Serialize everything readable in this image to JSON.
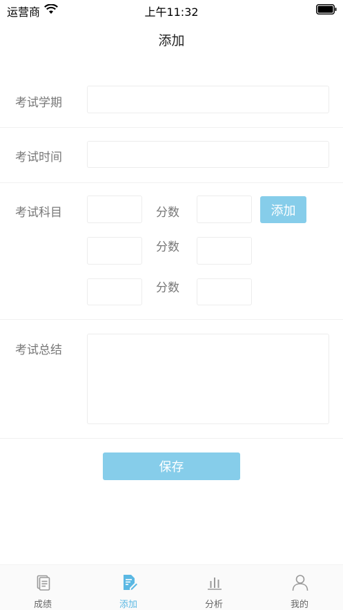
{
  "status_bar": {
    "carrier": "运营商",
    "time": "上午11:32"
  },
  "nav": {
    "title": "添加"
  },
  "form": {
    "semester_label": "考试学期",
    "semester_value": "",
    "time_label": "考试时间",
    "time_value": "",
    "subjects_label": "考试科目",
    "subject_rows": [
      {
        "subject": "",
        "score_label": "分数",
        "score": ""
      },
      {
        "subject": "",
        "score_label": "分数",
        "score": ""
      },
      {
        "subject": "",
        "score_label": "分数",
        "score": ""
      }
    ],
    "add_button": "添加",
    "summary_label": "考试总结",
    "summary_value": "",
    "save_button": "保存"
  },
  "tabs": [
    {
      "label": "成绩",
      "icon": "document-icon",
      "active": false
    },
    {
      "label": "添加",
      "icon": "edit-document-icon",
      "active": true
    },
    {
      "label": "分析",
      "icon": "bar-chart-icon",
      "active": false
    },
    {
      "label": "我的",
      "icon": "user-icon",
      "active": false
    }
  ],
  "colors": {
    "accent": "#86cdea",
    "tab_active": "#5bb8e3",
    "label": "#777777"
  }
}
